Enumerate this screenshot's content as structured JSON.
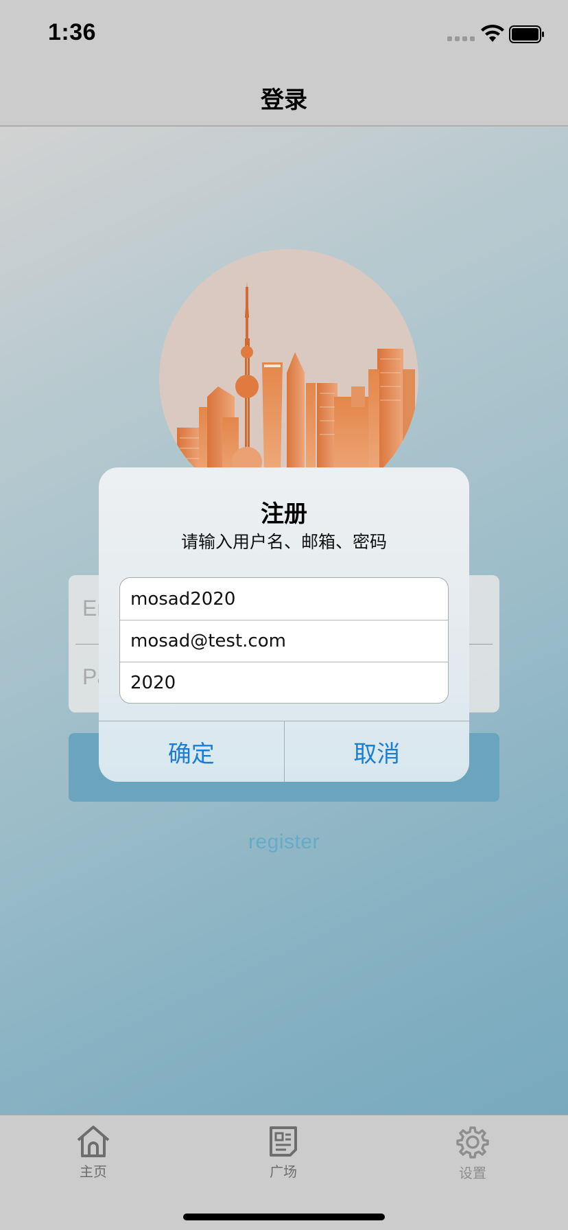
{
  "status_bar": {
    "time": "1:36"
  },
  "nav": {
    "title": "登录"
  },
  "login": {
    "email_placeholder": "Em",
    "password_placeholder": "Pa",
    "register_label": "register"
  },
  "alert": {
    "title": "注册",
    "message": "请输入用户名、邮箱、密码",
    "fields": {
      "username": "mosad2020",
      "email": "mosad@test.com",
      "password": "2020"
    },
    "confirm_label": "确定",
    "cancel_label": "取消"
  },
  "tabs": [
    {
      "label": "主页",
      "icon": "home-icon"
    },
    {
      "label": "广场",
      "icon": "document-icon"
    },
    {
      "label": "设置",
      "icon": "gear-icon"
    }
  ],
  "colors": {
    "accent_blue": "#1a7fd4",
    "login_button": "#6aa4bd",
    "register_link": "#65aac6",
    "hero_orange": "#e07a3e"
  }
}
